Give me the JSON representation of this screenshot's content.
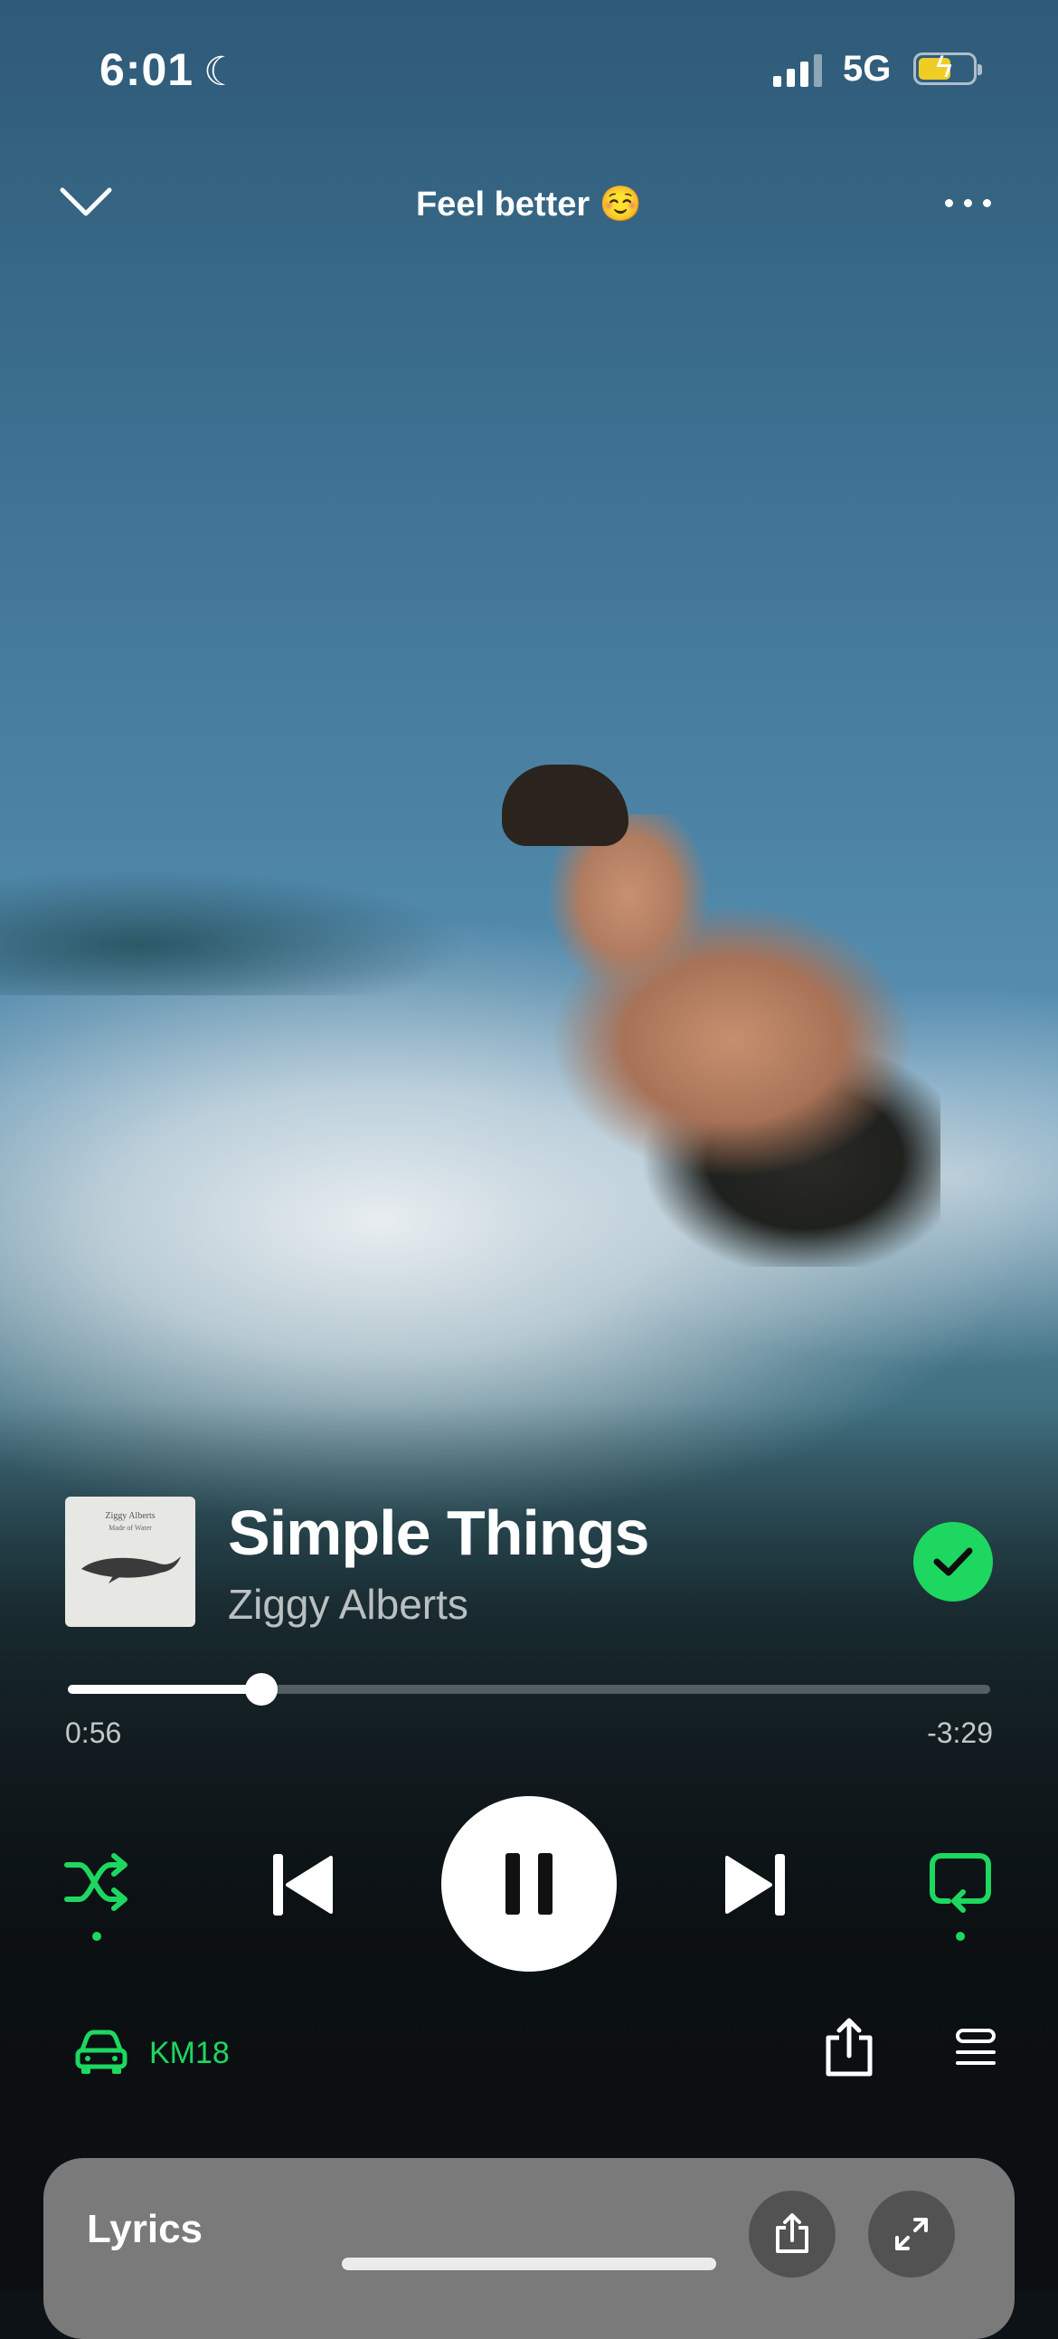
{
  "status_bar": {
    "time": "6:01",
    "network": "5G",
    "battery_level": 0.6
  },
  "header": {
    "playlist_title": "Feel better ☺️"
  },
  "track": {
    "title": "Simple Things",
    "artist": "Ziggy Alberts",
    "cover_text_line1": "Ziggy Alberts",
    "cover_text_line2": "Made of Water",
    "saved": true
  },
  "playback": {
    "elapsed": "0:56",
    "remaining": "-3:29",
    "progress": 0.21
  },
  "controls": {
    "shuffle_active": true,
    "repeat_active": true,
    "state": "playing"
  },
  "device": {
    "name": "KM18"
  },
  "lyrics_card": {
    "label": "Lyrics"
  },
  "colors": {
    "accent": "#1ed760",
    "battery": "#f0cd24",
    "lyrics_bg": "#7a7a7a"
  }
}
